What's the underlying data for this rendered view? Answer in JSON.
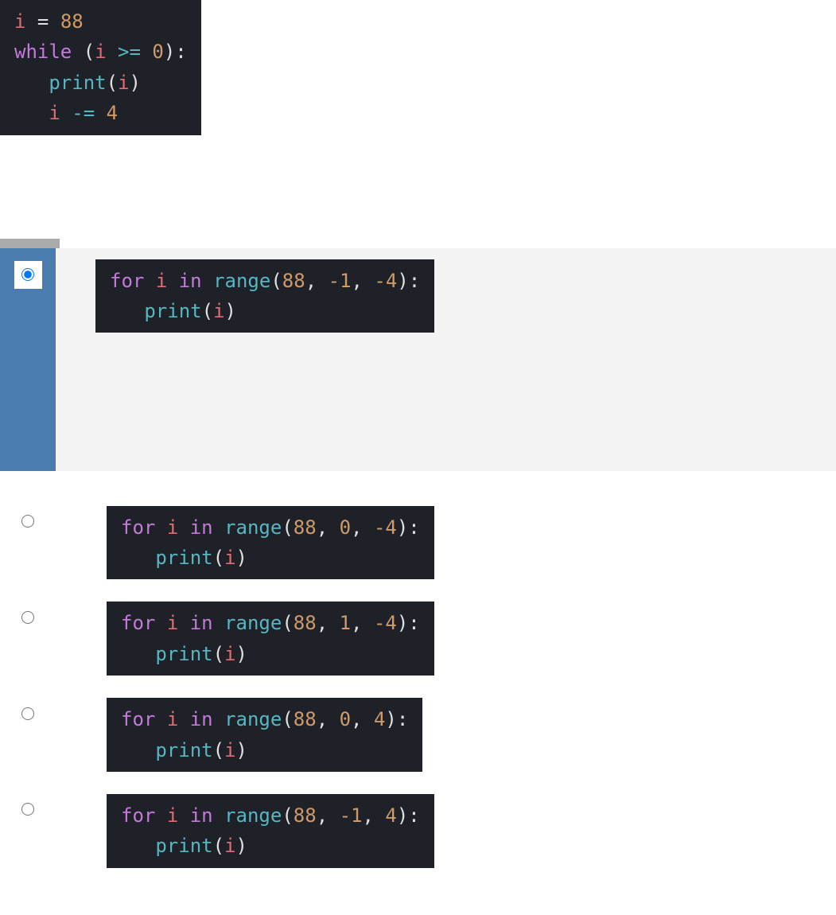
{
  "question_code": {
    "line1_var": "i",
    "line1_eq": " = ",
    "line1_num": "88",
    "line2_while": "while",
    "line2_space": " ",
    "line2_open": "(",
    "line2_var": "i",
    "line2_op": " >= ",
    "line2_zero": "0",
    "line2_close": "):",
    "line3_indent": "   ",
    "line3_print": "print",
    "line3_open": "(",
    "line3_var": "i",
    "line3_close": ")",
    "line4_indent": "   ",
    "line4_var": "i",
    "line4_op": " -= ",
    "line4_num": "4"
  },
  "options": [
    {
      "id": "opt1",
      "selected": true,
      "for": "for",
      "var": "i",
      "in": "in",
      "range": "range",
      "arg1": "88",
      "arg2": "-1",
      "arg3": "-4",
      "print": "print",
      "pvar": "i"
    },
    {
      "id": "opt2",
      "selected": false,
      "for": "for",
      "var": "i",
      "in": "in",
      "range": "range",
      "arg1": "88",
      "arg2": "0",
      "arg3": "-4",
      "print": "print",
      "pvar": "i"
    },
    {
      "id": "opt3",
      "selected": false,
      "for": "for",
      "var": "i",
      "in": "in",
      "range": "range",
      "arg1": "88",
      "arg2": "1",
      "arg3": "-4",
      "print": "print",
      "pvar": "i"
    },
    {
      "id": "opt4",
      "selected": false,
      "for": "for",
      "var": "i",
      "in": "in",
      "range": "range",
      "arg1": "88",
      "arg2": "0",
      "arg3": "4",
      "print": "print",
      "pvar": "i"
    },
    {
      "id": "opt5",
      "selected": false,
      "for": "for",
      "var": "i",
      "in": "in",
      "range": "range",
      "arg1": "88",
      "arg2": "-1",
      "arg3": "4",
      "print": "print",
      "pvar": "i"
    }
  ]
}
